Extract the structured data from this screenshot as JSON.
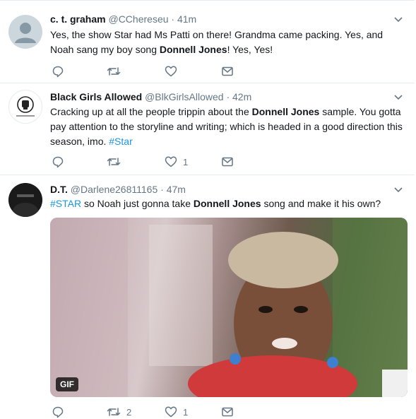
{
  "tweets": [
    {
      "name": "c. t. graham",
      "handle": "@CChereseu",
      "dot": "·",
      "time": "41m",
      "text_parts": [
        "Yes, the show Star had Ms Patti on there! Grandma came packing. Yes, and Noah sang my boy song ",
        "Donnell Jones",
        "! Yes, Yes!"
      ],
      "reply_count": "",
      "retweet_count": "",
      "like_count": ""
    },
    {
      "name": "Black Girls Allowed",
      "handle": "@BlkGirlsAllowed",
      "dot": "·",
      "time": "42m",
      "text_parts": [
        "Cracking up at all the people trippin about the ",
        "Donnell Jones",
        " sample. You gotta pay attention to the storyline and writing; which is headed in a good direction this season, imo. ",
        "#Star"
      ],
      "reply_count": "",
      "retweet_count": "",
      "like_count": "1"
    },
    {
      "name": "D.T.",
      "handle": "@Darlene26811165",
      "dot": "·",
      "time": "47m",
      "text_parts": [
        "#STAR",
        " so Noah just gonna take ",
        "Donnell Jones",
        " song and make it his own?"
      ],
      "media_badge": "GIF",
      "reply_count": "",
      "retweet_count": "2",
      "like_count": "1"
    }
  ],
  "icons": [
    "default-avatar-icon",
    "fist-logo-icon",
    "chevron-down-icon",
    "reply-icon",
    "retweet-icon",
    "like-icon",
    "direct-message-icon"
  ],
  "colors": {
    "link": "#1b95e0",
    "muted": "#657786",
    "border": "#e6ecf0",
    "text": "#14171a"
  }
}
